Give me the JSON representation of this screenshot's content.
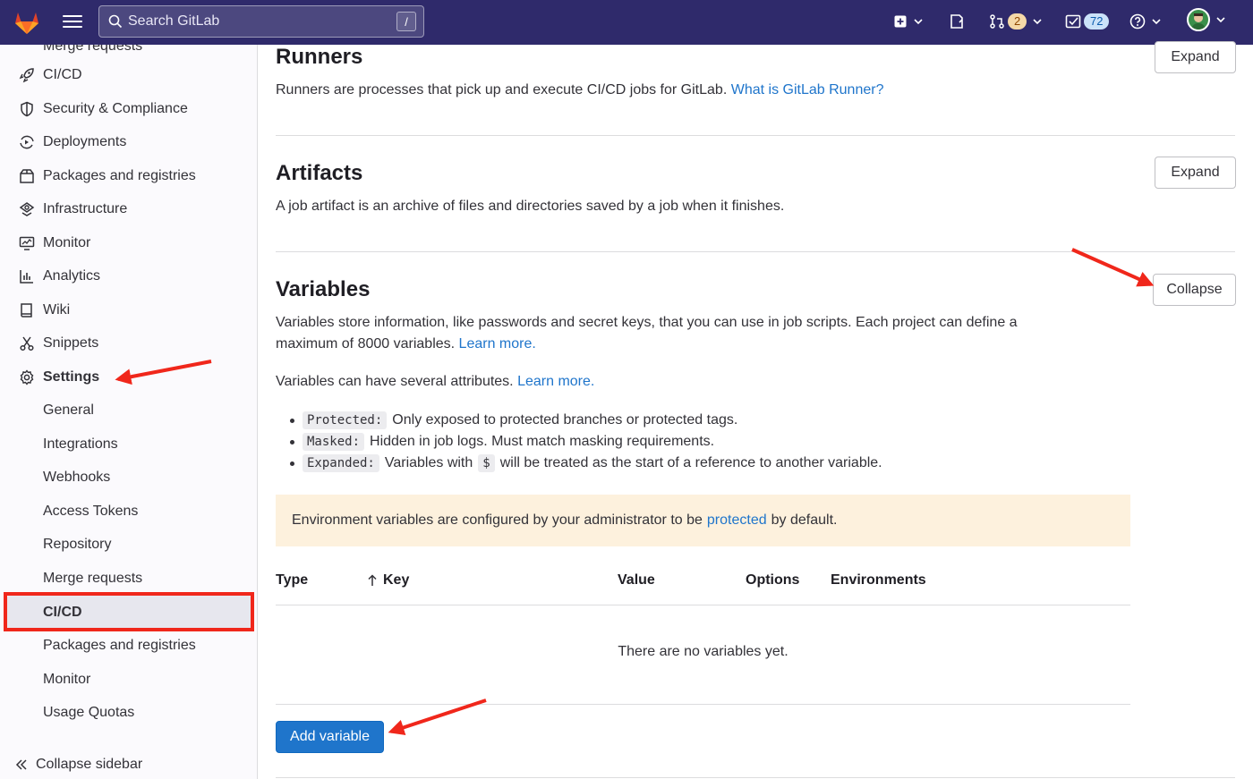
{
  "topbar": {
    "search_placeholder": "Search GitLab",
    "search_shortcut": "/",
    "merge_requests_count": "2",
    "todos_count": "72"
  },
  "sidebar": {
    "top_cut_label": "Merge requests",
    "items": [
      {
        "label": "CI/CD",
        "icon": "rocket-icon"
      },
      {
        "label": "Security & Compliance",
        "icon": "shield-icon"
      },
      {
        "label": "Deployments",
        "icon": "deployments-icon"
      },
      {
        "label": "Packages and registries",
        "icon": "package-icon"
      },
      {
        "label": "Infrastructure",
        "icon": "cloud-icon"
      },
      {
        "label": "Monitor",
        "icon": "monitor-icon"
      },
      {
        "label": "Analytics",
        "icon": "chart-icon"
      },
      {
        "label": "Wiki",
        "icon": "book-icon"
      },
      {
        "label": "Snippets",
        "icon": "scissors-icon"
      },
      {
        "label": "Settings",
        "icon": "gear-icon"
      }
    ],
    "settings_sub": [
      "General",
      "Integrations",
      "Webhooks",
      "Access Tokens",
      "Repository",
      "Merge requests",
      "CI/CD",
      "Packages and registries",
      "Monitor",
      "Usage Quotas"
    ],
    "collapse_label": "Collapse sidebar"
  },
  "runners": {
    "title": "Runners",
    "desc": "Runners are processes that pick up and execute CI/CD jobs for GitLab.",
    "link": "What is GitLab Runner?",
    "button": "Expand"
  },
  "artifacts": {
    "title": "Artifacts",
    "desc": "A job artifact is an archive of files and directories saved by a job when it finishes.",
    "button": "Expand"
  },
  "variables": {
    "title": "Variables",
    "button": "Collapse",
    "desc_line1": "Variables store information, like passwords and secret keys, that you can use in job scripts. Each project can define a",
    "desc_line2": "maximum of 8000 variables.",
    "learn_more_1": "Learn more.",
    "attributes_text": "Variables can have several attributes.",
    "learn_more_2": "Learn more.",
    "bullets": [
      {
        "code": "Protected:",
        "text": "Only exposed to protected branches or protected tags."
      },
      {
        "code": "Masked:",
        "text": "Hidden in job logs. Must match masking requirements."
      },
      {
        "code": "Expanded:",
        "text_before": "Variables with",
        "inline_code": "$",
        "text_after": "will be treated as the start of a reference to another variable."
      }
    ],
    "alert_before": "Environment variables are configured by your administrator to be",
    "alert_link": "protected",
    "alert_after": "by default.",
    "table_headers": {
      "type": "Type",
      "key": "Key",
      "value": "Value",
      "options": "Options",
      "environments": "Environments"
    },
    "empty_text": "There are no variables yet.",
    "add_button": "Add variable"
  },
  "colors": {
    "topbar": "#2f2a6b",
    "link": "#1f75cb",
    "primary": "#1f75cb",
    "annotation": "#f0271b",
    "alert_bg": "#fdf1dd"
  }
}
